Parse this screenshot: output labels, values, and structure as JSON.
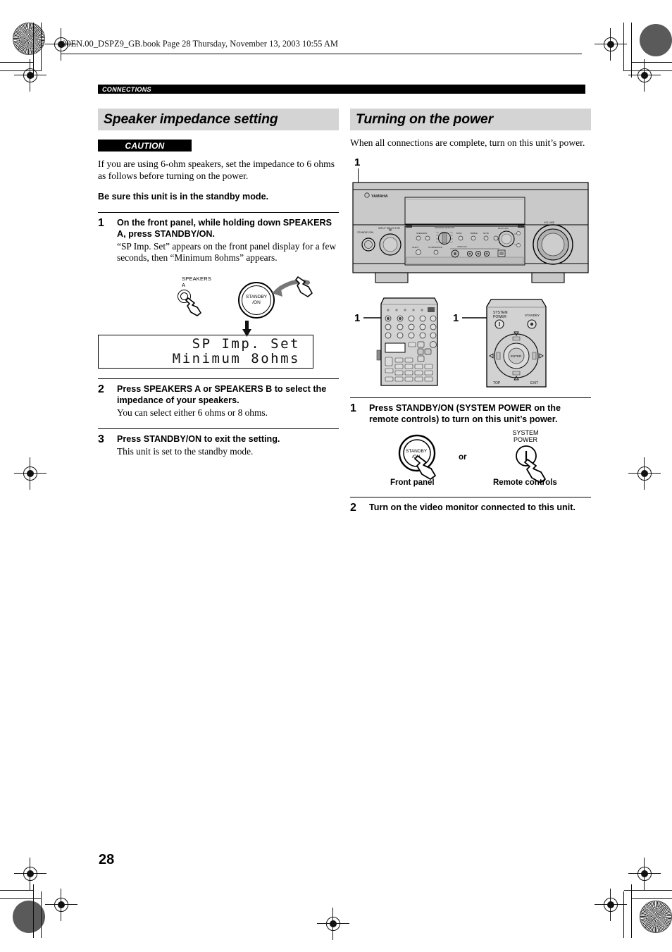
{
  "printer": {
    "file_header": "00EN.00_DSPZ9_GB.book  Page 28  Thursday, November 13, 2003  10:55 AM"
  },
  "page": {
    "number": "28",
    "running_head": "CONNECTIONS"
  },
  "left_column": {
    "section_title": "Speaker impedance setting",
    "caution_label": "CAUTION",
    "caution_text": "If you are using 6-ohm speakers, set the impedance to 6 ohms as follows before turning on the power.",
    "precondition": "Be sure this unit is in the standby mode.",
    "steps": [
      {
        "number": "1",
        "title": "On the front panel, while holding down SPEAKERS A, press STANDBY/ON.",
        "desc": "“SP Imp. Set” appears on the front panel display for a few seconds, then “Minimum 8ohms” appears."
      },
      {
        "number": "2",
        "title": "Press SPEAKERS A or SPEAKERS B to select the impedance of your speakers.",
        "desc": "You can select either 6 ohms or 8 ohms."
      },
      {
        "number": "3",
        "title": "Press STANDBY/ON to exit the setting.",
        "desc": "This unit is set to the standby mode."
      }
    ],
    "illustration": {
      "speakers_label": "SPEAKERS",
      "speakers_sub": "A",
      "standby_line1": "STANDBY",
      "standby_line2": "/ON"
    },
    "display": {
      "line1": "SP Imp. Set",
      "line2": "Minimum 8ohms"
    }
  },
  "right_column": {
    "section_title": "Turning on the power",
    "intro": "When all connections are complete, turn on this unit’s power.",
    "receiver_callout": "1",
    "remote_callout_left": "1",
    "remote_callout_right": "1",
    "steps": [
      {
        "number": "1",
        "title": "Press STANDBY/ON (SYSTEM POWER on the remote controls) to turn on this unit’s power."
      },
      {
        "number": "2",
        "title": "Turn on the video monitor connected to this unit."
      }
    ],
    "power_illustration": {
      "standby_line1": "STANDBY",
      "standby_line2": "/ON",
      "front_panel_caption": "Front panel",
      "or_label": "or",
      "system_power_line1": "SYSTEM",
      "system_power_line2": "POWER",
      "power_symbol": "I",
      "remote_caption": "Remote controls"
    },
    "receiver": {
      "brand": "YAMAHA",
      "input_selector_label": "INPUT SELECTOR",
      "volume_label": "VOLUME"
    },
    "remote_right": {
      "system_power": "SYSTEM POWER",
      "standby": "STANDBY",
      "enter": "ENTER",
      "top": "TOP",
      "exit": "EXIT"
    }
  },
  "colors": {
    "section_header_bg": "#d4d4d4",
    "running_head_bg": "#000000",
    "ink": "#000000",
    "panel_fill": "#c9c9c9"
  }
}
